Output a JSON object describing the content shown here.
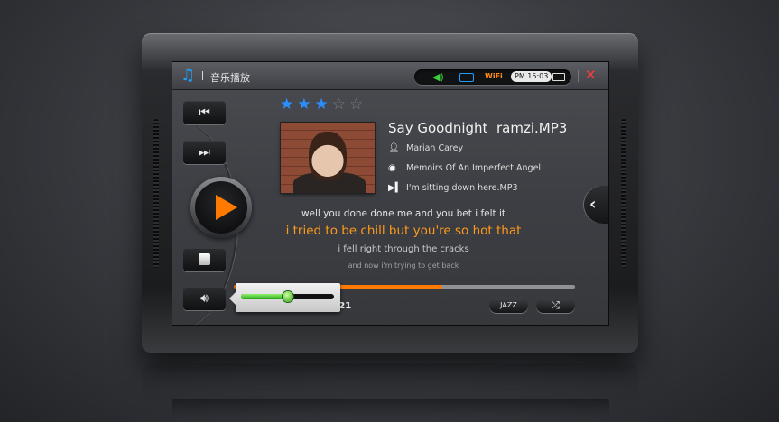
{
  "app": {
    "title": "音乐播放",
    "icon": "music-note-icon"
  },
  "status_bar": {
    "volume_icon": "speaker-icon",
    "keyboard_icon": "keyboard-icon",
    "wifi_label": "WiFi",
    "time": "PM 15:03",
    "battery_icon": "battery-icon",
    "close_icon": "close-icon",
    "colors": {
      "volume": "#3ecf3e",
      "keyboard": "#1f9cff",
      "wifi": "#ff8a1a",
      "close": "#ff3b3b"
    }
  },
  "controls": {
    "prev_icon": "skip-previous-icon",
    "next_icon": "skip-next-icon",
    "play_icon": "play-icon",
    "stop_icon": "stop-icon",
    "volume_icon": "volume-icon",
    "accent_color": "#ff7a00"
  },
  "rating": {
    "value": 3,
    "max": 5,
    "color": "#2c8dff"
  },
  "track": {
    "title": "Say Goodnight  ramzi.MP3",
    "artist": "Mariah Carey",
    "album": "Memoirs Of An Imperfect Angel",
    "next_up": "I'm sitting down here.MP3",
    "artist_icon": "person-icon",
    "album_icon": "disc-icon",
    "next_icon": "play-next-icon"
  },
  "lyrics": {
    "previous": "well you done done me and you bet i felt it",
    "current": "i tried to be chill but you're so hot that",
    "next": "i fell right through the cracks",
    "after": "and now i'm trying to get back",
    "highlight_color": "#ff9a1a"
  },
  "playback": {
    "progress_fraction": 0.61,
    "elapsed_hidden": "",
    "separator": "/",
    "total_time": "05:21"
  },
  "volume": {
    "level_fraction": 0.5
  },
  "buttons": {
    "eq_label": "JAZZ",
    "shuffle_icon": "shuffle-icon",
    "shuffle_glyph": "⤮"
  },
  "side_tab_icon": "chevron-left-icon"
}
